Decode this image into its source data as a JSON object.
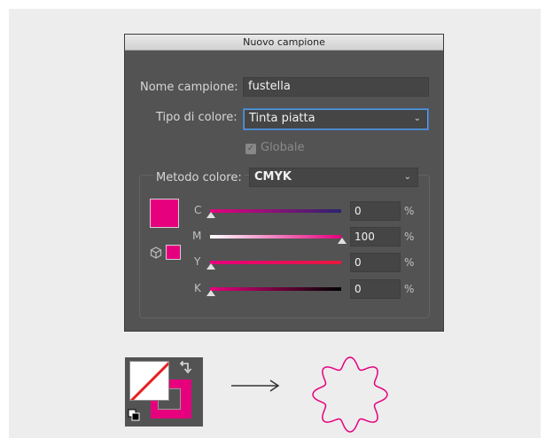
{
  "dialog": {
    "title": "Nuovo campione",
    "name_label": "Nome campione:",
    "name_value": "fustella",
    "color_type_label": "Tipo di colore:",
    "color_type_value": "Tinta piatta",
    "global_label": "Globale",
    "global_checked": true,
    "color_mode_label": "Metodo colore:",
    "color_mode_value": "CMYK",
    "swatch_color": "#e6007e",
    "channels": [
      {
        "label": "C",
        "value": "0",
        "unit": "%"
      },
      {
        "label": "M",
        "value": "100",
        "unit": "%"
      },
      {
        "label": "Y",
        "value": "0",
        "unit": "%"
      },
      {
        "label": "K",
        "value": "0",
        "unit": "%"
      }
    ]
  },
  "illustration": {
    "fill": "none",
    "stroke_color": "#e6007e",
    "arrow_glyph": "⟶",
    "shape": "wavy-star-outline"
  }
}
